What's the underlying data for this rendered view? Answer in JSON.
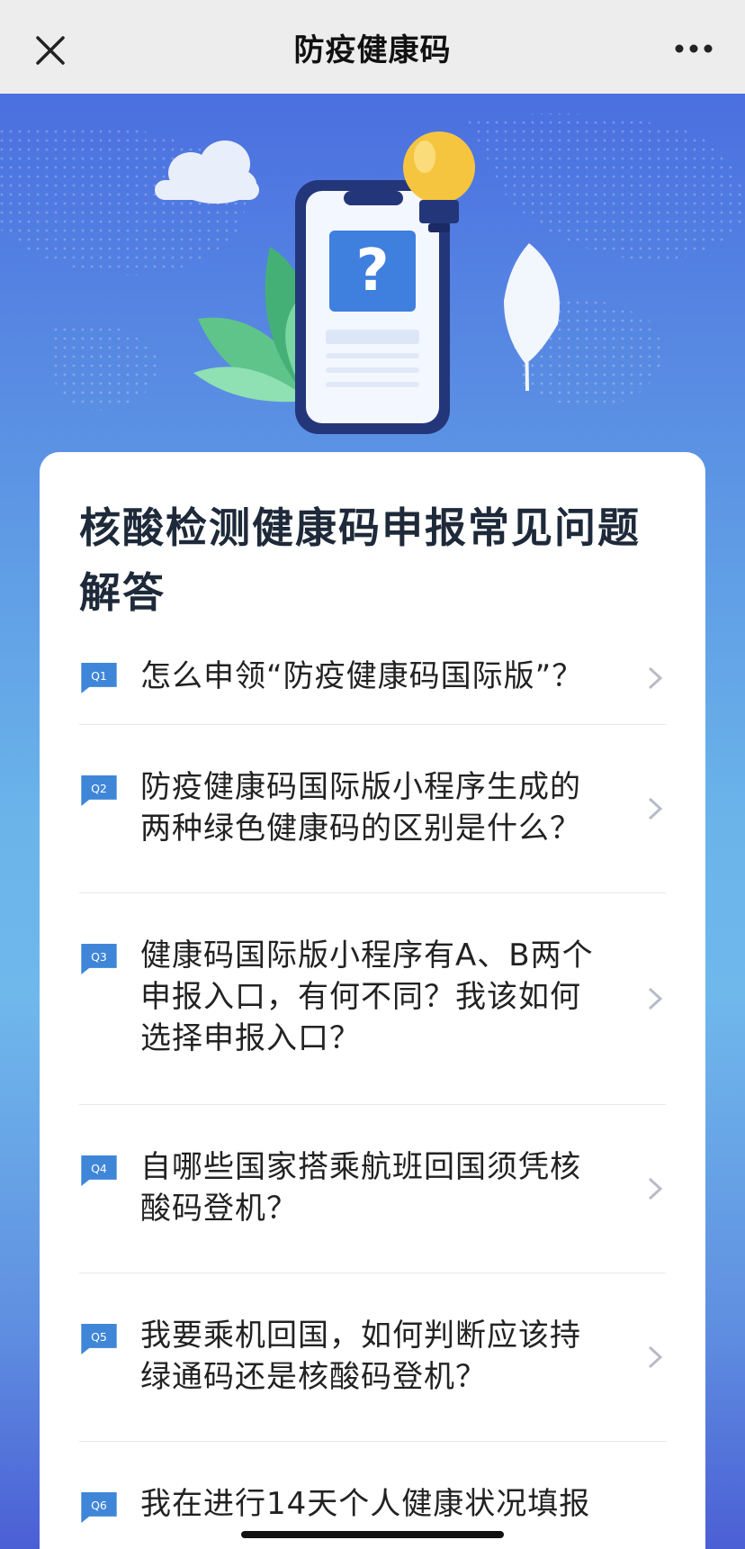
{
  "app": {
    "title": "防疫健康码",
    "close_icon": "close-icon",
    "more_icon": "more-dots-icon"
  },
  "hero": {
    "icons": [
      "cloud-icon",
      "phone-question-icon",
      "lightbulb-icon",
      "palm-leaf-icon",
      "leaf-icon"
    ],
    "question_mark": "?"
  },
  "card": {
    "title": "核酸检测健康码申报常见问题解答",
    "questions": [
      {
        "tag": "Q1",
        "text": "怎么申领“防疫健康码国际版”？"
      },
      {
        "tag": "Q2",
        "text": "防疫健康码国际版小程序生成的两种绿色健康码的区别是什么？"
      },
      {
        "tag": "Q3",
        "text": "健康码国际版小程序有A、B两个申报入口，有何不同？我该如何选择申报入口？"
      },
      {
        "tag": "Q4",
        "text": "自哪些国家搭乘航班回国须凭核酸码登机？"
      },
      {
        "tag": "Q5",
        "text": "我要乘机回国，如何判断应该持绿通码还是核酸码登机？"
      },
      {
        "tag": "Q6",
        "text": "我在进行14天个人健康状况填报"
      }
    ]
  },
  "colors": {
    "badge": "#3f86d8",
    "title_text": "#1e2a3a",
    "bg_top": "#4b6fe0",
    "bg_mid": "#6ab4ea"
  }
}
